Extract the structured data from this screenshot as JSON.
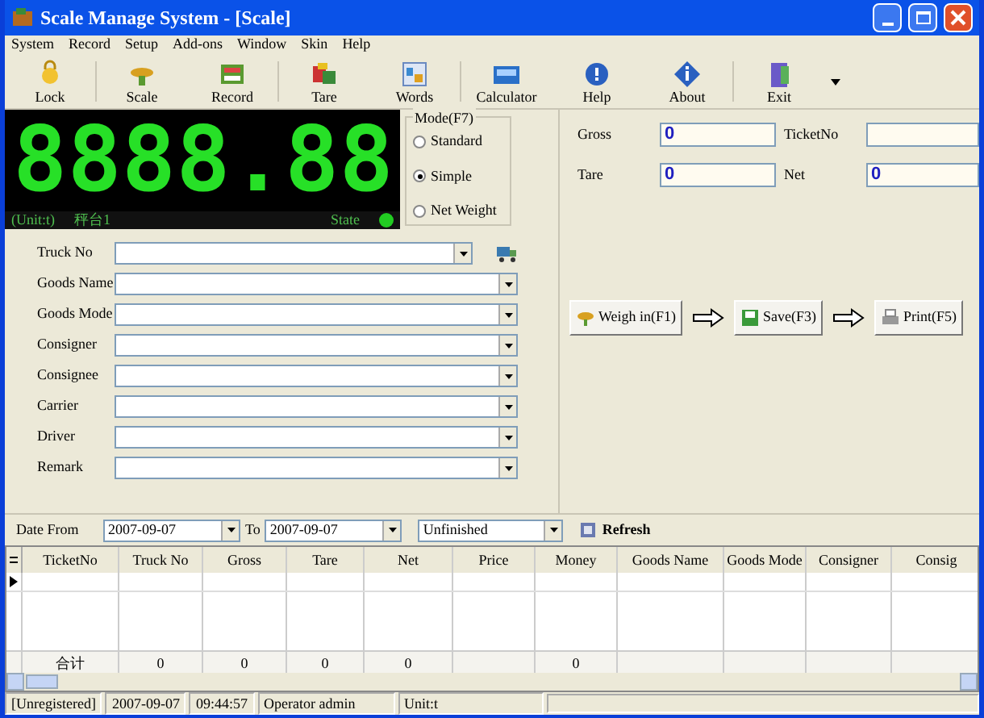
{
  "window": {
    "title": "Scale Manage System - [Scale]"
  },
  "menu": [
    "System",
    "Record",
    "Setup",
    "Add-ons",
    "Window",
    "Skin",
    "Help"
  ],
  "toolbar": [
    {
      "label": "Lock"
    },
    {
      "label": "Scale"
    },
    {
      "label": "Record"
    },
    {
      "label": "Tare"
    },
    {
      "label": "Words"
    },
    {
      "label": "Calculator"
    },
    {
      "label": "Help"
    },
    {
      "label": "About"
    },
    {
      "label": "Exit"
    }
  ],
  "display": {
    "reading": "8888.88",
    "unit": "(Unit:t)",
    "scale": "秤台1",
    "state_label": "State",
    "state_on": true
  },
  "mode": {
    "title": "Mode(F7)",
    "options": [
      {
        "label": "Standard",
        "selected": false
      },
      {
        "label": "Simple",
        "selected": true
      },
      {
        "label": "Net Weight",
        "selected": false
      }
    ]
  },
  "form": [
    {
      "label": "Truck No"
    },
    {
      "label": "Goods Name"
    },
    {
      "label": "Goods Mode"
    },
    {
      "label": "Consigner"
    },
    {
      "label": "Consignee"
    },
    {
      "label": "Carrier"
    },
    {
      "label": "Driver"
    },
    {
      "label": "Remark"
    }
  ],
  "weights": [
    {
      "label": "Gross",
      "value": "0"
    },
    {
      "label": "TicketNo"
    },
    {
      "label": "Tare",
      "value": "0"
    },
    {
      "label": "Net",
      "value": "0"
    }
  ],
  "actions": [
    {
      "label": "Weigh in(F1)"
    },
    {
      "label": "Save(F3)"
    },
    {
      "label": "Print(F5)"
    }
  ],
  "filter": {
    "from_label": "Date From",
    "from": "2007-09-07",
    "to_label": "To",
    "to": "2007-09-07",
    "status": "Unfinished",
    "refresh": "Refresh"
  },
  "table": {
    "columns": [
      "TicketNo",
      "Truck No",
      "Gross",
      "Tare",
      "Net",
      "Price",
      "Money",
      "Goods Name",
      "Goods Mode",
      "Consigner",
      "Consig"
    ],
    "totals": {
      "label": "合计",
      "truck_no": "0",
      "gross": "0",
      "tare": "0",
      "net": "0",
      "money": "0"
    }
  },
  "status_bar": [
    "[Unregistered]",
    "2007-09-07",
    "09:44:57",
    "Operator admin",
    "Unit:t"
  ]
}
